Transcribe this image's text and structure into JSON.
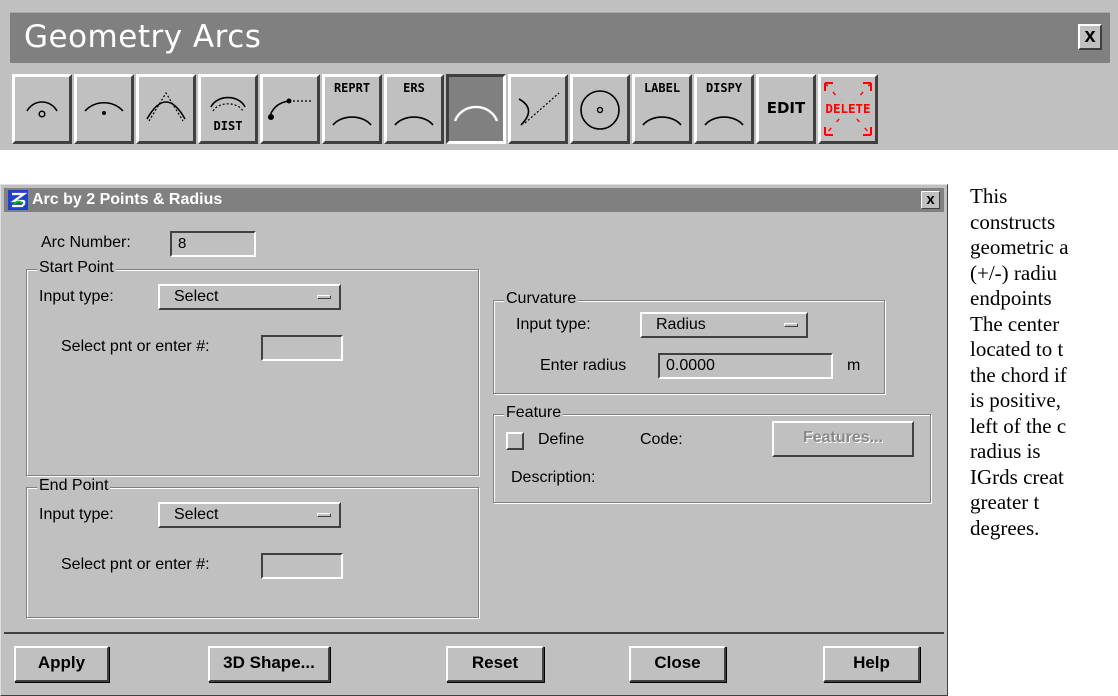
{
  "toolbar": {
    "title": "Geometry Arcs",
    "close_label": "x",
    "buttons": [
      {
        "icon": "arc-center-point-icon",
        "label": ""
      },
      {
        "icon": "arc-center-chord-icon",
        "label": ""
      },
      {
        "icon": "arc-three-points-icon",
        "label": ""
      },
      {
        "icon": "arc-distance-icon",
        "label": "DIST"
      },
      {
        "icon": "arc-point-tangent-icon",
        "label": ""
      },
      {
        "icon": "arc-report-icon",
        "label": "REPRT"
      },
      {
        "icon": "arc-erase-icon",
        "label": "ERS"
      },
      {
        "icon": "arc-two-points-radius-icon",
        "label": ""
      },
      {
        "icon": "arc-tangent-line-icon",
        "label": ""
      },
      {
        "icon": "circle-center-icon",
        "label": ""
      },
      {
        "icon": "arc-label-icon",
        "label": "LABEL"
      },
      {
        "icon": "arc-display-icon",
        "label": "DISPY"
      },
      {
        "icon": "arc-edit-icon",
        "label": "EDIT"
      },
      {
        "icon": "arc-delete-icon",
        "label": "DELETE"
      }
    ],
    "active_index": 7,
    "delete_color": "#ff0000"
  },
  "dialog": {
    "title": "Arc by 2 Points & Radius",
    "close_label": "x",
    "arc_number_label": "Arc Number:",
    "arc_number_value": "8",
    "start_point": {
      "legend": "Start Point",
      "input_type_label": "Input type:",
      "input_type_value": "Select",
      "select_label": "Select pnt or enter #:",
      "select_value": ""
    },
    "end_point": {
      "legend": "End Point",
      "input_type_label": "Input type:",
      "input_type_value": "Select",
      "select_label": "Select pnt or enter #:",
      "select_value": ""
    },
    "curvature": {
      "legend": "Curvature",
      "input_type_label": "Input type:",
      "input_type_value": "Radius",
      "radius_label": "Enter radius",
      "radius_value": "0.0000",
      "unit": "m"
    },
    "feature": {
      "legend": "Feature",
      "define_label": "Define",
      "define_checked": false,
      "code_label": "Code:",
      "features_button": "Features...",
      "description_label": "Description:"
    },
    "buttons": {
      "apply": "Apply",
      "shape3d": "3D Shape...",
      "reset": "Reset",
      "close": "Close",
      "help": "Help"
    }
  },
  "side_text": [
    "This",
    "constructs",
    "geometric a",
    "(+/-) radiu",
    "endpoints",
    "The center",
    "located to t",
    "the chord if",
    "is positive,",
    "left of the c",
    "radius is",
    "IGrds creat",
    "greater t",
    "degrees."
  ]
}
